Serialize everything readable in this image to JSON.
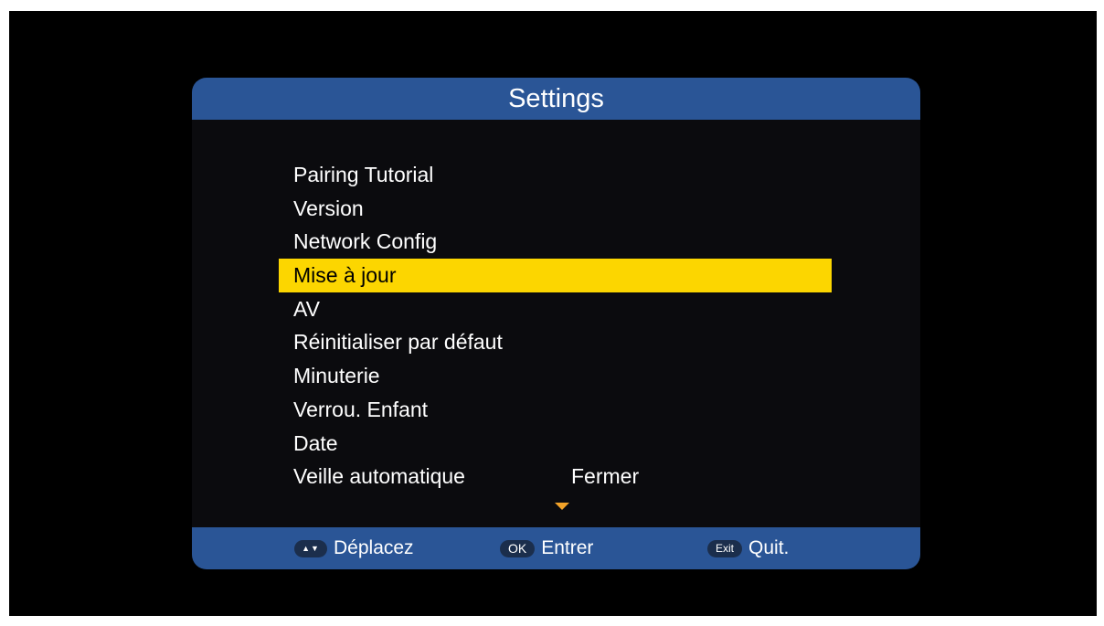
{
  "dialog": {
    "title": "Settings"
  },
  "menu": {
    "items": [
      {
        "label": "Pairing Tutorial"
      },
      {
        "label": "Version"
      },
      {
        "label": "Network Config"
      },
      {
        "label": "Mise à jour",
        "selected": true
      },
      {
        "label": "AV"
      },
      {
        "label": "Réinitialiser par défaut"
      },
      {
        "label": "Minuterie"
      },
      {
        "label": "Verrou. Enfant"
      },
      {
        "label": "Date"
      },
      {
        "label": "Veille automatique",
        "value": "Fermer"
      }
    ],
    "scroll_indicator": "down-arrow-icon"
  },
  "footer": {
    "hints": [
      {
        "key": "▲▼",
        "key_icon": "up-down-arrows-icon",
        "label": "Déplacez"
      },
      {
        "key": "OK",
        "label": "Entrer"
      },
      {
        "key": "Exit",
        "label": "Quit."
      }
    ]
  },
  "colors": {
    "panel_bar": "#2a5596",
    "highlight": "#fcd600",
    "scroll_arrow": "#f3a329",
    "panel_bg": "#0b0b0e"
  }
}
